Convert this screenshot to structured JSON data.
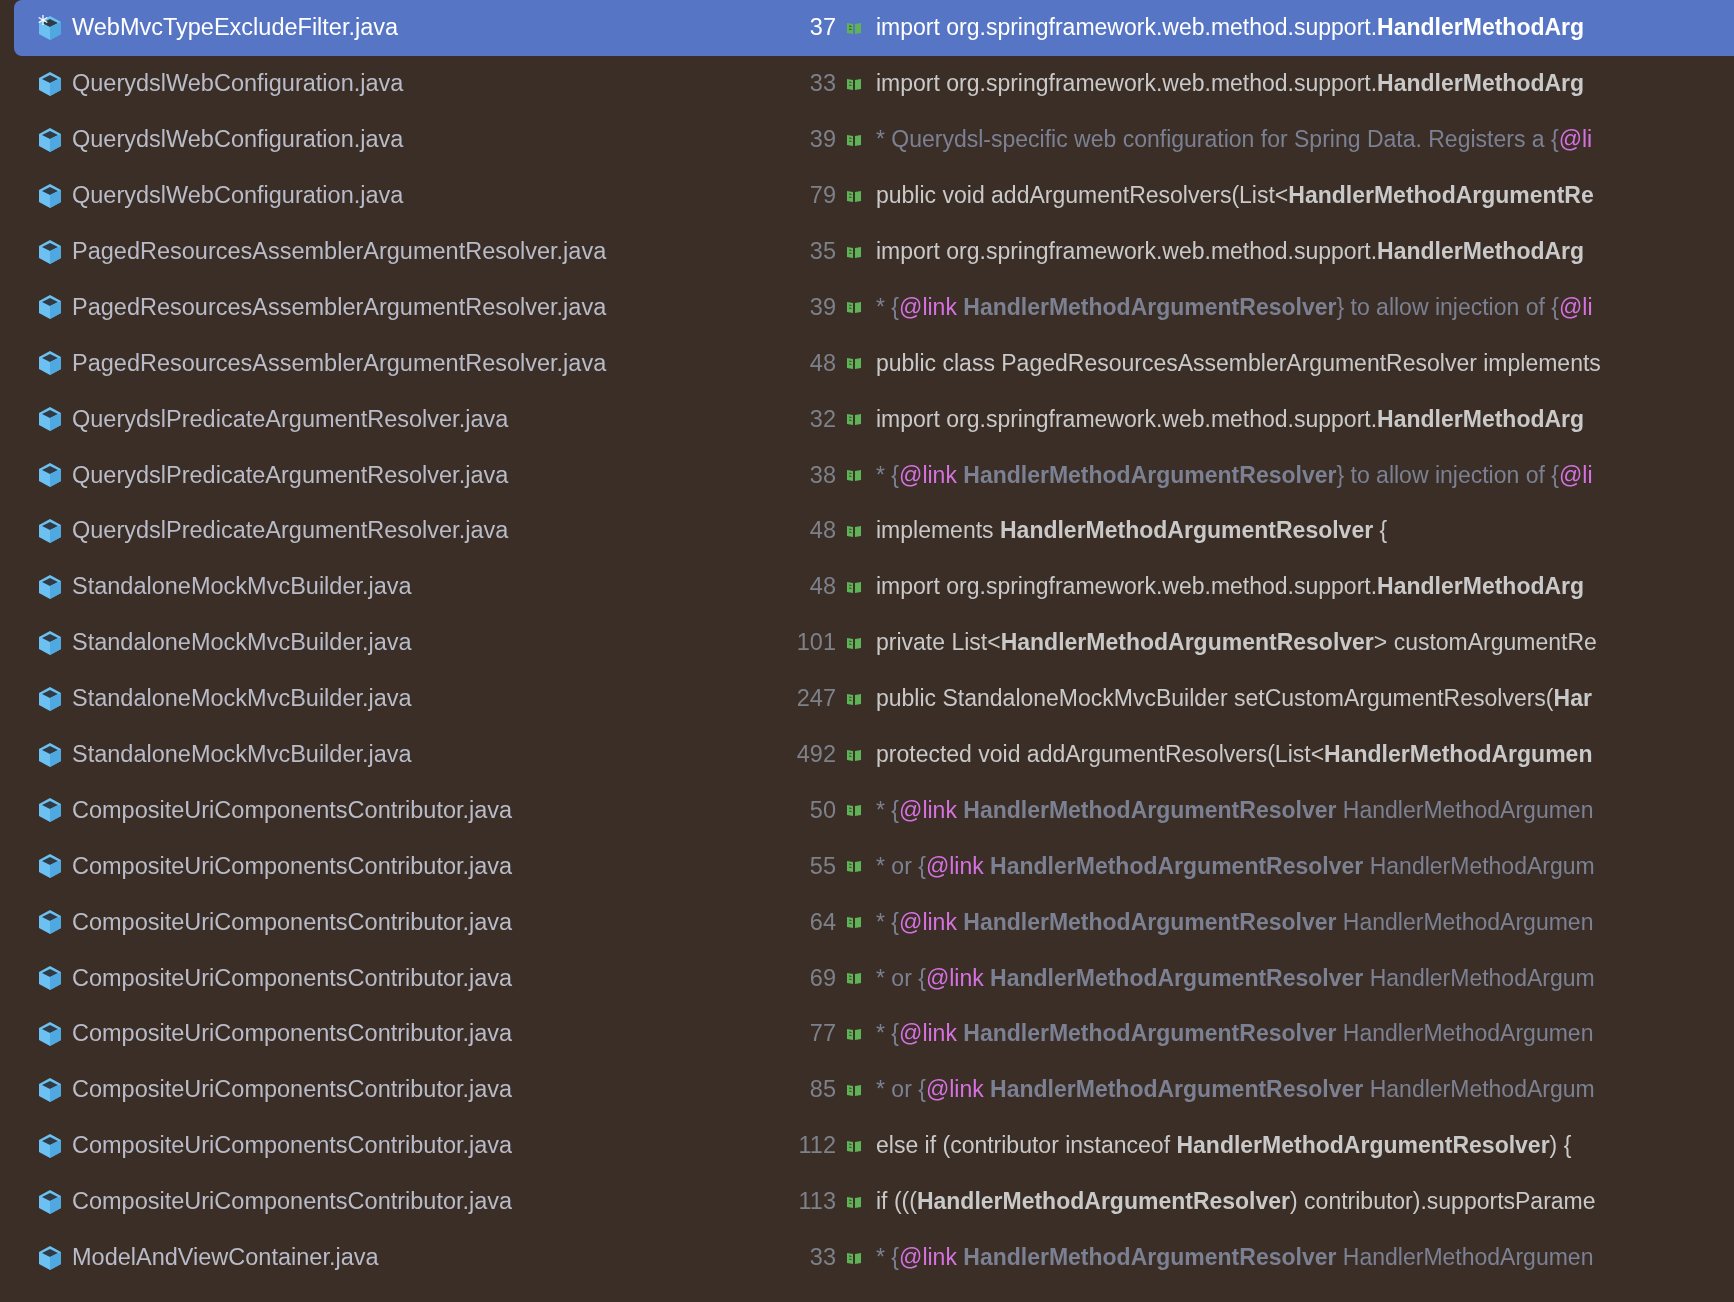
{
  "results": [
    {
      "file": "WebMvcTypeExcludeFilter.java",
      "spring_bean": true,
      "selected": true,
      "line": "37",
      "code": [
        {
          "kind": "plain",
          "text": "import org.springframework.web.method.support."
        },
        {
          "kind": "bold",
          "text": "HandlerMethodArg"
        }
      ]
    },
    {
      "file": "QuerydslWebConfiguration.java",
      "spring_bean": false,
      "selected": false,
      "line": "33",
      "code": [
        {
          "kind": "plain",
          "text": "import org.springframework.web.method.support."
        },
        {
          "kind": "bold",
          "text": "HandlerMethodArg"
        }
      ]
    },
    {
      "file": "QuerydslWebConfiguration.java",
      "spring_bean": false,
      "selected": false,
      "line": "39",
      "code": [
        {
          "kind": "doc",
          "text": "* Querydsl-specific web configuration for Spring Data. Registers a {"
        },
        {
          "kind": "tag",
          "text": "@li"
        }
      ]
    },
    {
      "file": "QuerydslWebConfiguration.java",
      "spring_bean": false,
      "selected": false,
      "line": "79",
      "code": [
        {
          "kind": "plain",
          "text": "public void addArgumentResolvers(List<"
        },
        {
          "kind": "bold",
          "text": "HandlerMethodArgumentRe"
        }
      ]
    },
    {
      "file": "PagedResourcesAssemblerArgumentResolver.java",
      "spring_bean": false,
      "selected": false,
      "line": "35",
      "code": [
        {
          "kind": "plain",
          "text": "import org.springframework.web.method.support."
        },
        {
          "kind": "bold",
          "text": "HandlerMethodArg"
        }
      ]
    },
    {
      "file": "PagedResourcesAssemblerArgumentResolver.java",
      "spring_bean": false,
      "selected": false,
      "line": "39",
      "code": [
        {
          "kind": "doc",
          "text": "* {"
        },
        {
          "kind": "tag",
          "text": "@link"
        },
        {
          "kind": "doc-bold",
          "text": " HandlerMethodArgumentResolver"
        },
        {
          "kind": "doc",
          "text": "} to allow injection of {"
        },
        {
          "kind": "tag",
          "text": "@li"
        }
      ]
    },
    {
      "file": "PagedResourcesAssemblerArgumentResolver.java",
      "spring_bean": false,
      "selected": false,
      "line": "48",
      "code": [
        {
          "kind": "plain",
          "text": "public class PagedResourcesAssemblerArgumentResolver implements"
        }
      ]
    },
    {
      "file": "QuerydslPredicateArgumentResolver.java",
      "spring_bean": false,
      "selected": false,
      "line": "32",
      "code": [
        {
          "kind": "plain",
          "text": "import org.springframework.web.method.support."
        },
        {
          "kind": "bold",
          "text": "HandlerMethodArg"
        }
      ]
    },
    {
      "file": "QuerydslPredicateArgumentResolver.java",
      "spring_bean": false,
      "selected": false,
      "line": "38",
      "code": [
        {
          "kind": "doc",
          "text": "* {"
        },
        {
          "kind": "tag",
          "text": "@link"
        },
        {
          "kind": "doc-bold",
          "text": " HandlerMethodArgumentResolver"
        },
        {
          "kind": "doc",
          "text": "} to allow injection of {"
        },
        {
          "kind": "tag",
          "text": "@li"
        }
      ]
    },
    {
      "file": "QuerydslPredicateArgumentResolver.java",
      "spring_bean": false,
      "selected": false,
      "line": "48",
      "code": [
        {
          "kind": "plain",
          "text": "implements "
        },
        {
          "kind": "bold",
          "text": "HandlerMethodArgumentResolver"
        },
        {
          "kind": "plain",
          "text": " {"
        }
      ]
    },
    {
      "file": "StandaloneMockMvcBuilder.java",
      "spring_bean": false,
      "selected": false,
      "line": "48",
      "code": [
        {
          "kind": "plain",
          "text": "import org.springframework.web.method.support."
        },
        {
          "kind": "bold",
          "text": "HandlerMethodArg"
        }
      ]
    },
    {
      "file": "StandaloneMockMvcBuilder.java",
      "spring_bean": false,
      "selected": false,
      "line": "101",
      "code": [
        {
          "kind": "plain",
          "text": "private List<"
        },
        {
          "kind": "bold",
          "text": "HandlerMethodArgumentResolver"
        },
        {
          "kind": "plain",
          "text": "> customArgumentRe"
        }
      ]
    },
    {
      "file": "StandaloneMockMvcBuilder.java",
      "spring_bean": false,
      "selected": false,
      "line": "247",
      "code": [
        {
          "kind": "plain",
          "text": "public StandaloneMockMvcBuilder setCustomArgumentResolvers("
        },
        {
          "kind": "bold",
          "text": "Har"
        }
      ]
    },
    {
      "file": "StandaloneMockMvcBuilder.java",
      "spring_bean": false,
      "selected": false,
      "line": "492",
      "code": [
        {
          "kind": "plain",
          "text": "protected void addArgumentResolvers(List<"
        },
        {
          "kind": "bold",
          "text": "HandlerMethodArgumen"
        }
      ]
    },
    {
      "file": "CompositeUriComponentsContributor.java",
      "spring_bean": false,
      "selected": false,
      "line": "50",
      "code": [
        {
          "kind": "doc",
          "text": "* {"
        },
        {
          "kind": "tag",
          "text": "@link"
        },
        {
          "kind": "doc-bold",
          "text": " HandlerMethodArgumentResolver"
        },
        {
          "kind": "doc",
          "text": " HandlerMethodArgumen"
        }
      ]
    },
    {
      "file": "CompositeUriComponentsContributor.java",
      "spring_bean": false,
      "selected": false,
      "line": "55",
      "code": [
        {
          "kind": "doc",
          "text": "* or {"
        },
        {
          "kind": "tag",
          "text": "@link"
        },
        {
          "kind": "doc-bold",
          "text": " HandlerMethodArgumentResolver"
        },
        {
          "kind": "doc",
          "text": " HandlerMethodArgum"
        }
      ]
    },
    {
      "file": "CompositeUriComponentsContributor.java",
      "spring_bean": false,
      "selected": false,
      "line": "64",
      "code": [
        {
          "kind": "doc",
          "text": "* {"
        },
        {
          "kind": "tag",
          "text": "@link"
        },
        {
          "kind": "doc-bold",
          "text": " HandlerMethodArgumentResolver"
        },
        {
          "kind": "doc",
          "text": " HandlerMethodArgumen"
        }
      ]
    },
    {
      "file": "CompositeUriComponentsContributor.java",
      "spring_bean": false,
      "selected": false,
      "line": "69",
      "code": [
        {
          "kind": "doc",
          "text": "* or {"
        },
        {
          "kind": "tag",
          "text": "@link"
        },
        {
          "kind": "doc-bold",
          "text": " HandlerMethodArgumentResolver"
        },
        {
          "kind": "doc",
          "text": " HandlerMethodArgum"
        }
      ]
    },
    {
      "file": "CompositeUriComponentsContributor.java",
      "spring_bean": false,
      "selected": false,
      "line": "77",
      "code": [
        {
          "kind": "doc",
          "text": "* {"
        },
        {
          "kind": "tag",
          "text": "@link"
        },
        {
          "kind": "doc-bold",
          "text": " HandlerMethodArgumentResolver"
        },
        {
          "kind": "doc",
          "text": " HandlerMethodArgumen"
        }
      ]
    },
    {
      "file": "CompositeUriComponentsContributor.java",
      "spring_bean": false,
      "selected": false,
      "line": "85",
      "code": [
        {
          "kind": "doc",
          "text": "* or {"
        },
        {
          "kind": "tag",
          "text": "@link"
        },
        {
          "kind": "doc-bold",
          "text": " HandlerMethodArgumentResolver"
        },
        {
          "kind": "doc",
          "text": " HandlerMethodArgum"
        }
      ]
    },
    {
      "file": "CompositeUriComponentsContributor.java",
      "spring_bean": false,
      "selected": false,
      "line": "112",
      "code": [
        {
          "kind": "plain",
          "text": "else if (contributor instanceof "
        },
        {
          "kind": "bold",
          "text": "HandlerMethodArgumentResolver"
        },
        {
          "kind": "plain",
          "text": ") {"
        }
      ]
    },
    {
      "file": "CompositeUriComponentsContributor.java",
      "spring_bean": false,
      "selected": false,
      "line": "113",
      "code": [
        {
          "kind": "plain",
          "text": "if ((("
        },
        {
          "kind": "bold",
          "text": "HandlerMethodArgumentResolver"
        },
        {
          "kind": "plain",
          "text": ") contributor).supportsParame"
        }
      ]
    },
    {
      "file": "ModelAndViewContainer.java",
      "spring_bean": false,
      "selected": false,
      "line": "33",
      "code": [
        {
          "kind": "doc",
          "text": "* {"
        },
        {
          "kind": "tag",
          "text": "@link"
        },
        {
          "kind": "doc-bold",
          "text": " HandlerMethodArgumentResolver"
        },
        {
          "kind": "doc",
          "text": " HandlerMethodArgumen"
        }
      ]
    }
  ]
}
